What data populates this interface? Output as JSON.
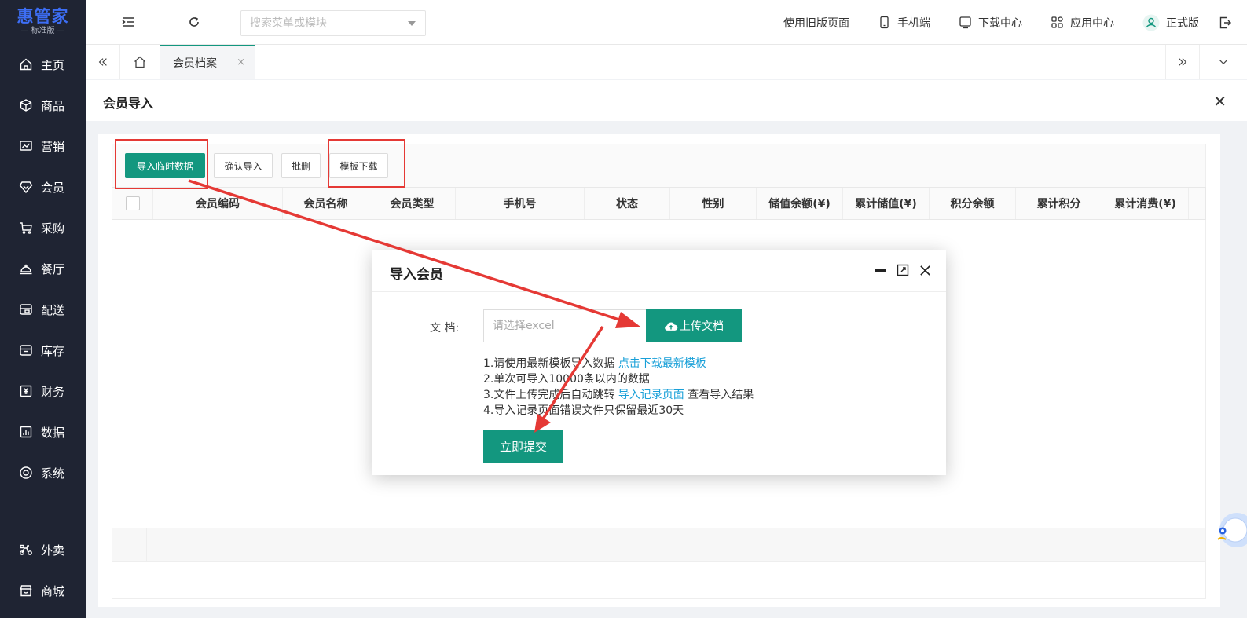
{
  "brand": {
    "name": "惠管家",
    "edition": "标准版"
  },
  "sidebar": {
    "items": [
      {
        "label": "主页",
        "icon": "home-icon"
      },
      {
        "label": "商品",
        "icon": "box-icon"
      },
      {
        "label": "营销",
        "icon": "chart-icon"
      },
      {
        "label": "会员",
        "icon": "diamond-icon"
      },
      {
        "label": "采购",
        "icon": "cart-icon"
      },
      {
        "label": "餐厅",
        "icon": "cloche-icon"
      },
      {
        "label": "配送",
        "icon": "truck-icon"
      },
      {
        "label": "库存",
        "icon": "inventory-icon"
      },
      {
        "label": "财务",
        "icon": "yen-icon"
      },
      {
        "label": "数据",
        "icon": "bar-chart-icon"
      },
      {
        "label": "系统",
        "icon": "settings-icon"
      }
    ],
    "bottom_items": [
      {
        "label": "外卖",
        "icon": "scooter-icon"
      },
      {
        "label": "商城",
        "icon": "store-icon"
      }
    ]
  },
  "topbar": {
    "search_placeholder": "搜索菜单或模块",
    "old_page": "使用旧版页面",
    "mobile": "手机端",
    "download_center": "下载中心",
    "app_center": "应用中心",
    "version": "正式版"
  },
  "tabs": [
    {
      "label": "会员档案",
      "close": "×"
    }
  ],
  "page": {
    "title": "会员导入",
    "close": "✕"
  },
  "toolbar": {
    "import_temp": "导入临时数据",
    "confirm_import": "确认导入",
    "batch_delete": "批删",
    "template_download": "模板下载"
  },
  "table": {
    "columns": [
      "会员编码",
      "会员名称",
      "会员类型",
      "手机号",
      "状态",
      "性别",
      "储值余额(¥)",
      "累计储值(¥)",
      "积分余额",
      "累计积分",
      "累计消费(¥)"
    ]
  },
  "modal": {
    "title": "导入会员",
    "file_label": "文 档:",
    "file_placeholder": "请选择excel",
    "upload_label": "上传文档",
    "notes": {
      "n1_prefix": "1.请使用最新模板导入数据 ",
      "n1_link": "点击下载最新模板",
      "n2": "2.单次可导入10000条以内的数据",
      "n3_prefix": "3.文件上传完成后自动跳转 ",
      "n3_link": "导入记录页面",
      "n3_suffix": " 查看导入结果",
      "n4": "4.导入记录页面错误文件只保留最近30天"
    },
    "submit": "立即提交"
  },
  "colors": {
    "primary": "#13977f",
    "sidebar": "#1f2433",
    "brand": "#3d6ef5",
    "link": "#19a0d8",
    "annotation": "#e53935"
  }
}
